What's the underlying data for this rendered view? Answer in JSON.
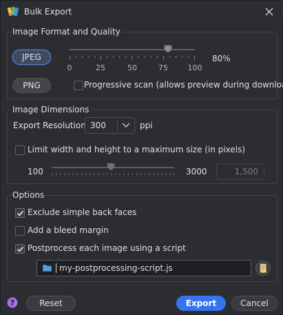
{
  "window": {
    "title": "Bulk Export",
    "icons": {
      "app": "paint-palette-icon",
      "close": "close-icon"
    }
  },
  "image_format": {
    "legend": "Image Format and Quality",
    "jpeg_label": "JPEG",
    "png_label": "PNG",
    "selected_format": "JPEG",
    "quality_ticks": [
      "0",
      "25",
      "50",
      "75",
      "100"
    ],
    "quality_value": 80,
    "quality_readout": "80%",
    "progressive_label": "Progressive scan (allows preview during download)",
    "progressive_checked": false
  },
  "image_dimensions": {
    "legend": "Image Dimensions",
    "resolution_label": "Export Resolution",
    "resolution_value": "300",
    "resolution_unit": "ppi",
    "limit_label": "Limit width and height to a maximum size (in pixels)",
    "limit_checked": false,
    "size_min_label": "100",
    "size_max_label": "3000",
    "size_value": "1,500"
  },
  "options": {
    "legend": "Options",
    "exclude_label": "Exclude simple back faces",
    "exclude_checked": true,
    "bleed_label": "Add a bleed margin",
    "bleed_checked": false,
    "postprocess_label": "Postprocess each image using a script",
    "postprocess_checked": true,
    "script_path": "my-postprocessing-script.js",
    "icons": {
      "folder": "folder-icon",
      "browse": "script-file-icon"
    }
  },
  "footer": {
    "help_icon": "help-icon",
    "reset_label": "Reset",
    "export_label": "Export",
    "cancel_label": "Cancel"
  },
  "colors": {
    "accent": "#3574f0",
    "help": "#a571e6",
    "background": "#2b2d30"
  }
}
